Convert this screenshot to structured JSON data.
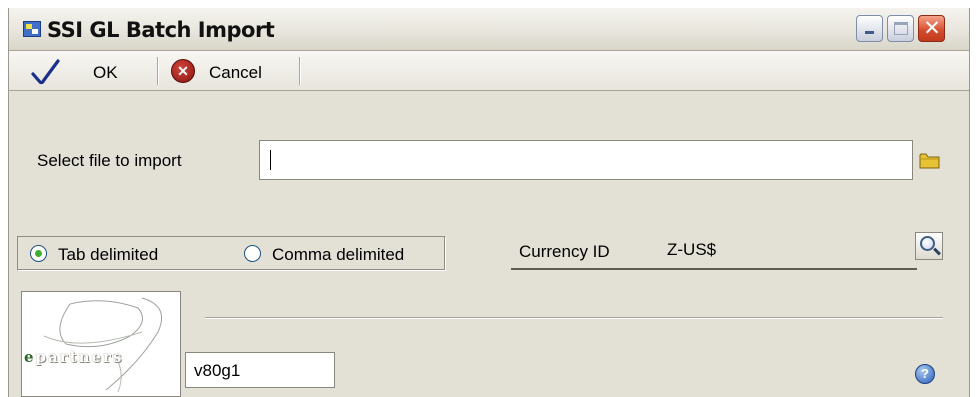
{
  "window": {
    "title": "SSI GL Batch Import",
    "icons": {
      "minimize": "minimize-icon",
      "maximize": "maximize-icon",
      "close": "close-icon"
    }
  },
  "toolbar": {
    "ok_label": "OK",
    "cancel_label": "Cancel",
    "ok_icon": "checkmark-icon",
    "cancel_icon": "cancel-x-icon"
  },
  "file": {
    "label": "Select file to import",
    "value": "",
    "browse_icon": "folder-icon"
  },
  "delimiter": {
    "options": [
      {
        "label": "Tab delimited",
        "selected": true
      },
      {
        "label": "Comma delimited",
        "selected": false
      }
    ]
  },
  "currency": {
    "label": "Currency ID",
    "value": "Z-US$",
    "lookup_icon": "magnifier-icon"
  },
  "logo": {
    "word": "epartners"
  },
  "version": {
    "value": "v80g1"
  },
  "help": {
    "icon": "help-icon"
  },
  "colors": {
    "background": "#e3e1d6",
    "close_button": "#d44a2c",
    "radio_selected": "#3fae2e",
    "help_icon": "#2c5fb8"
  }
}
